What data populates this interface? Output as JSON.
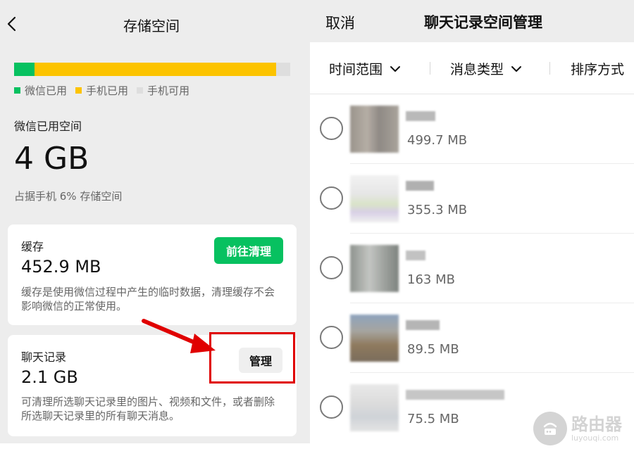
{
  "left": {
    "header": {
      "title": "存储空间"
    },
    "storage_bar": {
      "wechat_fraction": 0.075,
      "phone_fraction": 0.875
    },
    "legend": [
      {
        "label": "微信已用",
        "color": "#07c160"
      },
      {
        "label": "手机已用",
        "color": "#fcc300"
      },
      {
        "label": "手机可用",
        "color": "#dedede"
      }
    ],
    "wechat_used": {
      "label": "微信已用空间",
      "value": "4 GB",
      "description": "占据手机 6% 存储空间"
    },
    "cache": {
      "title": "缓存",
      "value": "452.9 MB",
      "button_label": "前往清理",
      "description": "缓存是使用微信过程中产生的临时数据，清理缓存不会影响微信的正常使用。"
    },
    "chat_records": {
      "title": "聊天记录",
      "value": "2.1 GB",
      "button_label": "管理",
      "description": "可清理所选聊天记录里的图片、视频和文件，或者删除所选聊天记录里的所有聊天消息。"
    }
  },
  "right": {
    "header": {
      "cancel_label": "取消",
      "title": "聊天记录空间管理"
    },
    "filters": [
      {
        "label": "时间范围"
      },
      {
        "label": "消息类型"
      },
      {
        "label": "排序方式"
      }
    ],
    "chats": [
      {
        "size": "499.7 MB"
      },
      {
        "size": "355.3 MB"
      },
      {
        "size": "163 MB"
      },
      {
        "size": "89.5 MB"
      },
      {
        "size": "75.5 MB"
      }
    ]
  },
  "colors": {
    "accent_green": "#07c160",
    "phone_yellow": "#fcc300",
    "highlight_red": "#e00000"
  },
  "watermark": {
    "main": "路由器",
    "sub": "luyouqi.com"
  }
}
